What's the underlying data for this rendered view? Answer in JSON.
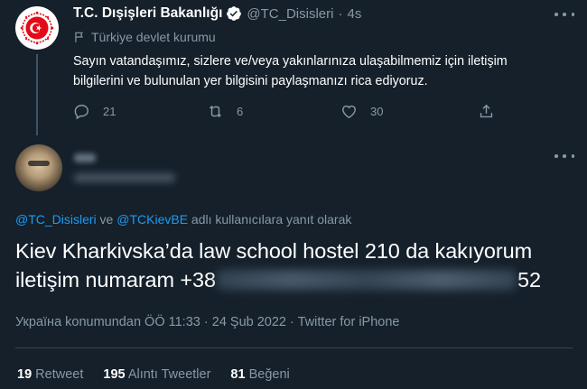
{
  "parent_tweet": {
    "name": "T.C. Dışişleri Bakanlığı",
    "handle": "@TC_Disisleri",
    "separator": "·",
    "time": "4s",
    "account_label": "Türkiye devlet kurumu",
    "text": "Sayın vatandaşımız, sizlere ve/veya yakınlarınıza ulaşabilmemiz için iletişim bilgilerini ve bulunulan yer bilgisini paylaşmanızı rica ediyoruz.",
    "replies": "21",
    "retweets": "6",
    "likes": "30"
  },
  "reply_tweet": {
    "reply_prefix_1": "@TC_Disisleri",
    "reply_connector": " ve ",
    "reply_prefix_2": "@TCKievBE",
    "reply_suffix": " adlı kullanıcılara yanıt olarak",
    "text_line1": "Kiev Kharkivska’da law school hostel 210 da kakıyorum",
    "text_line2_start": "iletişim numaram +38",
    "text_line2_end": "52",
    "location": "Україна konumundan",
    "time": "ÖÖ 11:33",
    "date": "24 Şub 2022",
    "dot": "·",
    "client": "Twitter for iPhone"
  },
  "stats": {
    "retweets_count": "19",
    "retweets_label": "Retweet",
    "quotes_count": "195",
    "quotes_label": "Alıntı Tweetler",
    "likes_count": "81",
    "likes_label": "Beğeni"
  },
  "colors": {
    "background": "#15202b",
    "link": "#1d9bf0",
    "muted": "#8899a6",
    "seal_red": "#e30a17"
  }
}
